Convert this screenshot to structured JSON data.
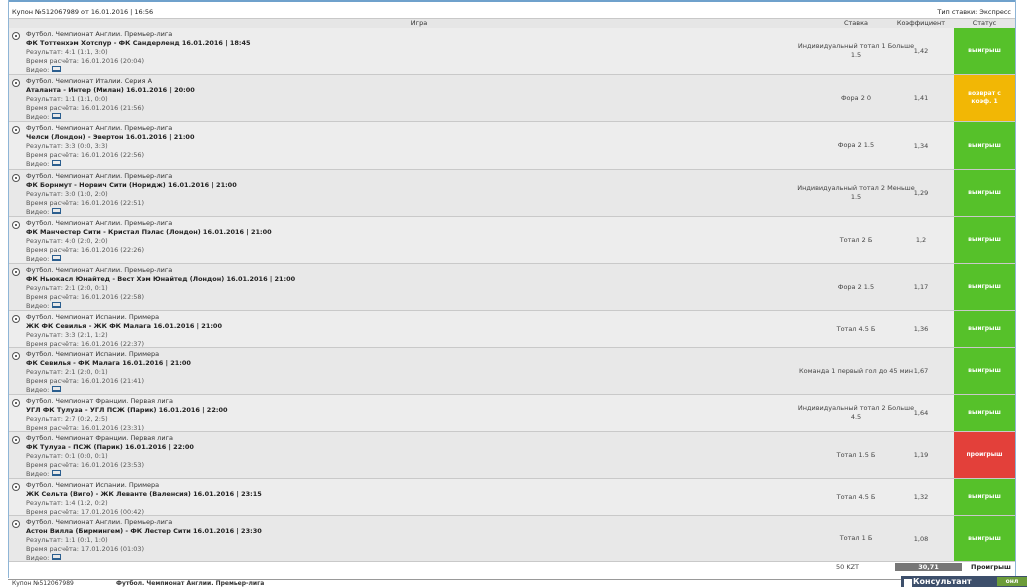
{
  "coupon": {
    "title": "Купон №512067989 от 16.01.2016 | 16:56",
    "bet_type": "Тип ставки: Экспресс"
  },
  "columns": {
    "game": "Игра",
    "bet": "Ставка",
    "coef": "Коэффициент",
    "status": "Статус"
  },
  "labels": {
    "video": "Видео:"
  },
  "rows": [
    {
      "league": "Футбол. Чемпионат Англии. Премьер-лига",
      "match": "ФК Тоттенхэм Хотспур - ФК Сандерленд 16.01.2016 | 18:45",
      "result": "Результат: 4:1 (1:1, 3:0)",
      "calc": "Время расчёта: 16.01.2016 (20:04)",
      "bet": "Индивидуальный тотал 1 Больше 1.5",
      "coef": "1,42",
      "status": "выигрыш",
      "status_kind": "win"
    },
    {
      "league": "Футбол. Чемпионат Италии. Серия А",
      "match": "Аталанта - Интер (Милан) 16.01.2016 | 20:00",
      "result": "Результат: 1:1 (1:1, 0:0)",
      "calc": "Время расчёта: 16.01.2016 (21:56)",
      "bet": "Фора 2 0",
      "coef": "1,41",
      "status": "возврат с коэф. 1",
      "status_kind": "return"
    },
    {
      "league": "Футбол. Чемпионат Англии. Премьер-лига",
      "match": "Челси (Лондон) - Эвертон 16.01.2016 | 21:00",
      "result": "Результат: 3:3 (0:0, 3:3)",
      "calc": "Время расчёта: 16.01.2016 (22:56)",
      "bet": "Фора 2 1.5",
      "coef": "1,34",
      "status": "выигрыш",
      "status_kind": "win"
    },
    {
      "league": "Футбол. Чемпионат Англии. Премьер-лига",
      "match": "ФК Борнмут - Норвич Сити (Норидж) 16.01.2016 | 21:00",
      "result": "Результат: 3:0 (1:0, 2:0)",
      "calc": "Время расчёта: 16.01.2016 (22:51)",
      "bet": "Индивидуальный тотал 2 Меньше 1.5",
      "coef": "1,29",
      "status": "выигрыш",
      "status_kind": "win"
    },
    {
      "league": "Футбол. Чемпионат Англии. Премьер-лига",
      "match": "ФК Манчестер Сити - Кристал Пэлас (Лондон) 16.01.2016 | 21:00",
      "result": "Результат: 4:0 (2:0, 2:0)",
      "calc": "Время расчёта: 16.01.2016 (22:26)",
      "bet": "Тотал 2 Б",
      "coef": "1,2",
      "status": "выигрыш",
      "status_kind": "win"
    },
    {
      "league": "Футбол. Чемпионат Англии. Премьер-лига",
      "match": "ФК Ньюкасл Юнайтед - Вест Хэм Юнайтед (Лондон) 16.01.2016 | 21:00",
      "result": "Результат: 2:1 (2:0, 0:1)",
      "calc": "Время расчёта: 16.01.2016 (22:58)",
      "bet": "Фора 2 1.5",
      "coef": "1,17",
      "status": "выигрыш",
      "status_kind": "win"
    },
    {
      "league": "Футбол. Чемпионат Испании. Примера",
      "match": "ЖК ФК Севилья - ЖК ФК Малага 16.01.2016 | 21:00",
      "result": "Результат: 3:3 (2:1, 1:2)",
      "calc": "Время расчёта: 16.01.2016 (22:37)",
      "bet": "Тотал 4.5 Б",
      "coef": "1,36",
      "status": "выигрыш",
      "status_kind": "win"
    },
    {
      "league": "Футбол. Чемпионат Испании. Примера",
      "match": "ФК Севилья - ФК Малага 16.01.2016 | 21:00",
      "result": "Результат: 2:1 (2:0, 0:1)",
      "calc": "Время расчёта: 16.01.2016 (21:41)",
      "bet": "Команда 1 первый гол до 45 мин",
      "coef": "1,67",
      "status": "выигрыш",
      "status_kind": "win"
    },
    {
      "league": "Футбол. Чемпионат Франции. Первая лига",
      "match": "УГЛ ФК Тулуза - УГЛ ПСЖ (Парик) 16.01.2016 | 22:00",
      "result": "Результат: 2:7 (0:2, 2:5)",
      "calc": "Время расчёта: 16.01.2016 (23:31)",
      "bet": "Индивидуальный тотал 2 Больше 4.5",
      "coef": "1,64",
      "status": "выигрыш",
      "status_kind": "win"
    },
    {
      "league": "Футбол. Чемпионат Франции. Первая лига",
      "match": "ФК Тулуза - ПСЖ (Парик) 16.01.2016 | 22:00",
      "result": "Результат: 0:1 (0:0, 0:1)",
      "calc": "Время расчёта: 16.01.2016 (23:53)",
      "bet": "Тотал 1.5 Б",
      "coef": "1,19",
      "status": "проигрыш",
      "status_kind": "lose"
    },
    {
      "league": "Футбол. Чемпионат Испании. Примера",
      "match": "ЖК Сельта (Виго) - ЖК Леванте (Валенсия) 16.01.2016 | 23:15",
      "result": "Результат: 1:4 (1:2, 0:2)",
      "calc": "Время расчёта: 17.01.2016 (00:42)",
      "bet": "Тотал 4.5 Б",
      "coef": "1,32",
      "status": "выигрыш",
      "status_kind": "win"
    },
    {
      "league": "Футбол. Чемпионат Англии. Премьер-лига",
      "match": "Астон Вилла (Бирмингем) - ФК Лестер Сити 16.01.2016 | 23:30",
      "result": "Результат: 1:1 (0:1, 1:0)",
      "calc": "Время расчёта: 17.01.2016 (01:03)",
      "bet": "Тотал 1 Б",
      "coef": "1,08",
      "status": "выигрыш",
      "status_kind": "win"
    }
  ],
  "totals": {
    "stake": "50 KZT",
    "coef": "30,71",
    "status": "Проигрыш"
  },
  "bottom_strip": {
    "coupon": "Купон №512067989",
    "league": "Футбол. Чемпионат Англии. Премьер-лига"
  },
  "consultant": {
    "label": "Консультант",
    "online": "онл"
  }
}
